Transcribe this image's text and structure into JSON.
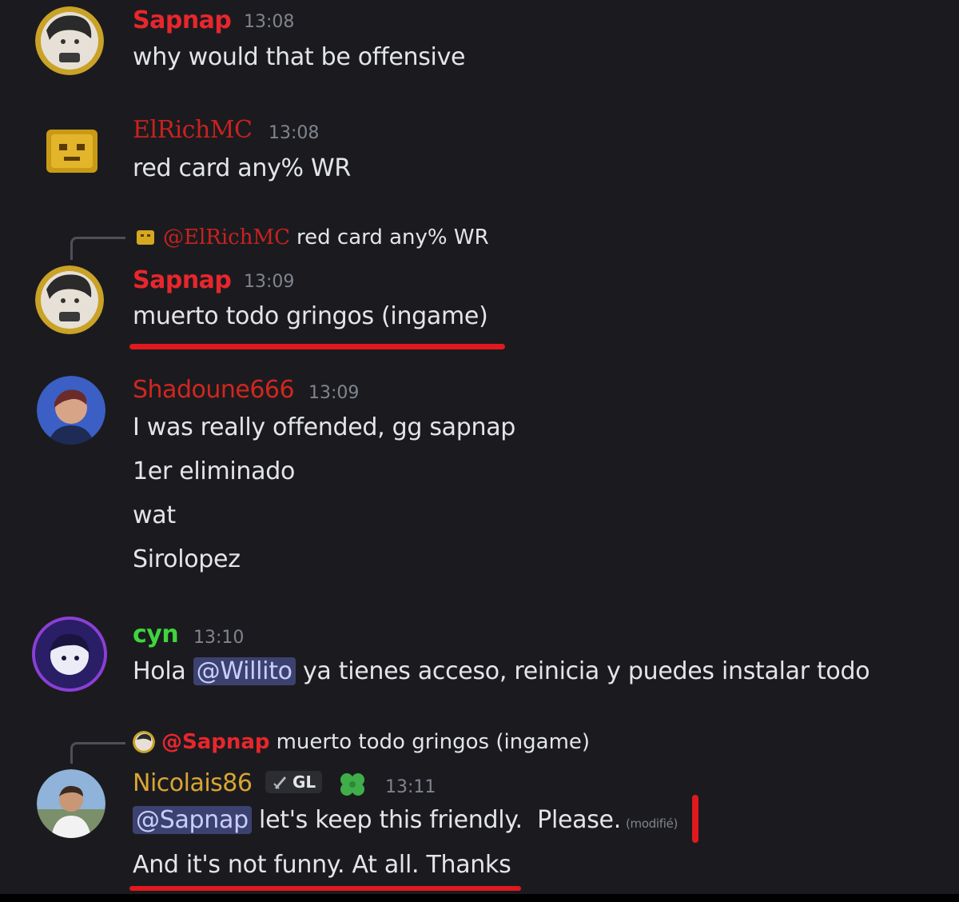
{
  "messages": [
    {
      "author": "Sapnap",
      "time": "13:08",
      "lines": [
        "why would that be offensive"
      ]
    },
    {
      "author": "ElRichMC",
      "time": "13:08",
      "lines": [
        "red card any% WR"
      ]
    },
    {
      "reply": {
        "author": "@ElRichMC",
        "text": "red card any% WR"
      },
      "author": "Sapnap",
      "time": "13:09",
      "lines": [
        "muerto todo gringos (ingame)"
      ]
    },
    {
      "author": "Shadoune666",
      "time": "13:09",
      "lines": [
        "I was really offended, gg sapnap",
        "1er eliminado",
        "wat",
        "Sirolopez"
      ]
    },
    {
      "author": "cyn",
      "time": "13:10",
      "line_parts": {
        "before": "Hola ",
        "mention": "@Willito",
        "after": " ya tienes acceso, reinicia y puedes instalar todo"
      }
    },
    {
      "reply": {
        "author": "@Sapnap",
        "text": "muerto todo gringos (ingame)"
      },
      "author": "Nicolais86",
      "tag": "GL",
      "time": "13:11",
      "line_parts": {
        "mention": "@Sapnap",
        "after": " let's keep this friendly.  Please.",
        "edited": "(modifié)"
      },
      "line2": "And it's not funny. At all. Thanks"
    }
  ],
  "colors": {
    "sapnap": "#e8262d",
    "elrich": "#c8221f",
    "shadoune": "#d2261f",
    "cyn": "#3ed53e",
    "nicolais": "#d9a533",
    "annotation": "#e0191f"
  },
  "icons": {
    "tag_icon": "sword-icon",
    "clover": "clover-icon"
  }
}
